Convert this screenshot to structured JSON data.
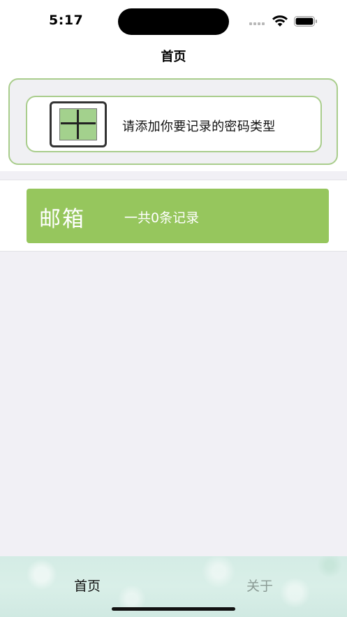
{
  "status_bar": {
    "time": "5:17"
  },
  "nav": {
    "title": "首页"
  },
  "add_prompt": {
    "label": "请添加你要记录的密码类型",
    "icon": "plus-icon",
    "accent_color": "#a3d18d",
    "border_color": "#a9cd8c"
  },
  "categories": [
    {
      "name": "邮箱",
      "count_text": "一共0条记录",
      "color": "#96c65d"
    }
  ],
  "tab_bar": {
    "tabs": [
      {
        "label": "首页",
        "selected": true
      },
      {
        "label": "关于",
        "selected": false
      }
    ]
  }
}
